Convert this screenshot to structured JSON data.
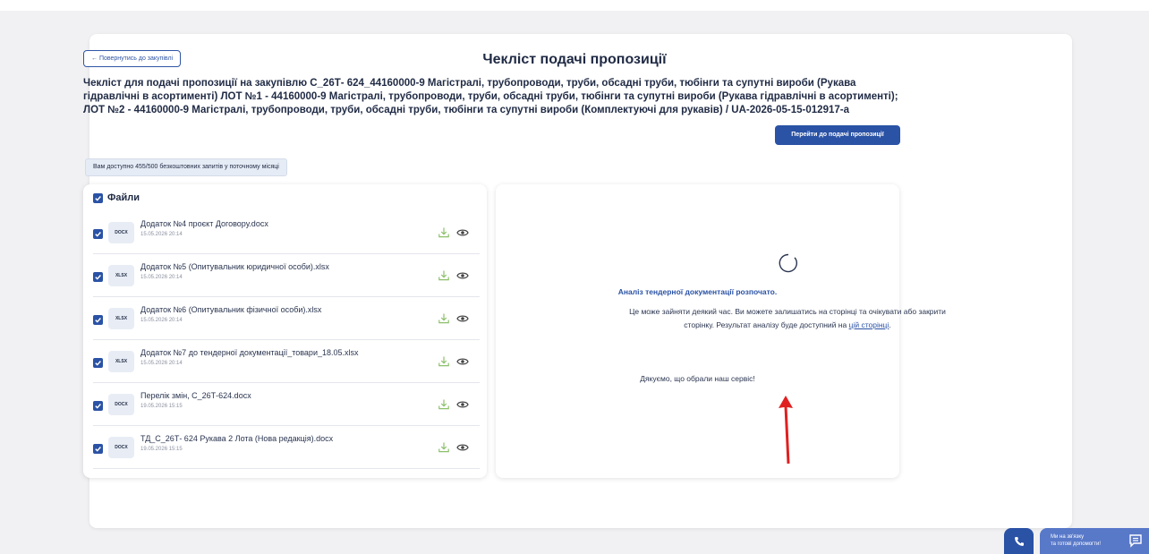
{
  "page": {
    "title": "Чекліст подачі пропозиції",
    "back_label": "← Повернутись до закупівлі",
    "procurement_title": "Чекліст для подачі пропозиції на закупівлю С_26Т- 624_44160000-9 Магістралі, трубопроводи, труби, обсадні труби, тюбінги та супутні вироби (Рукава гідравлічні в асортименті) ЛОТ №1 - 44160000-9 Магістралі, трубопроводи, труби, обсадні труби, тюбінги та супутні вироби (Рукава гідравлічні в асортименті); ЛОТ №2 - 44160000-9 Магістралі, трубопроводи, труби, обсадні труби, тюбінги та супутні вироби (Комплектуючі для рукавів) / UA-2026-05-15-012917-a",
    "submit_button": "Перейти до подачі пропозиції",
    "quota_text": "Вам доступно 455/500 безкоштовних запитів у поточному місяці"
  },
  "files": {
    "header": "Файли",
    "items": [
      {
        "type": "DOCX",
        "name": "Додаток №4 проєкт Договору.docx",
        "date": "15.05.2026 20:14"
      },
      {
        "type": "XLSX",
        "name": "Додаток №5 (Опитувальник юридичної особи).xlsx",
        "date": "15.05.2026 20:14"
      },
      {
        "type": "XLSX",
        "name": "Додаток №6 (Опитувальник фізичної особи).xlsx",
        "date": "15.05.2026 20:14"
      },
      {
        "type": "XLSX",
        "name": "Додаток №7 до тендерної документації_товари_18.05.xlsx",
        "date": "15.05.2026 20:14"
      },
      {
        "type": "DOCX",
        "name": "Перелік змін, С_26Т-624.docx",
        "date": "19.05.2026 15:15"
      },
      {
        "type": "DOCX",
        "name": "ТД_С_26Т- 624 Рукава 2 Лота (Нова редакція).docx",
        "date": "19.05.2026 15:15"
      }
    ]
  },
  "analysis": {
    "title": "Аналіз тендерної документації розпочато.",
    "body_1": "Це може зайняти деякий час. Ви можете залишатись на сторінці та очікувати або закрити сторінку. Результат аналізу буде доступний",
    "body_prefix": "на",
    "link": "цій сторінці",
    "body_suffix": ".",
    "thanks": "Дякуємо, що обрали наш сервіс!"
  },
  "support": {
    "line1": "Ми на зв'язку",
    "line2": "та готові допомогти!"
  },
  "colors": {
    "accent": "#2a52a5",
    "annotation_arrow": "#e02020",
    "background": "#f1f1f3"
  },
  "icons": [
    "check-icon",
    "download-icon",
    "eye-icon",
    "spinner-icon",
    "phone-icon",
    "chat-icon",
    "arrow-icon"
  ]
}
